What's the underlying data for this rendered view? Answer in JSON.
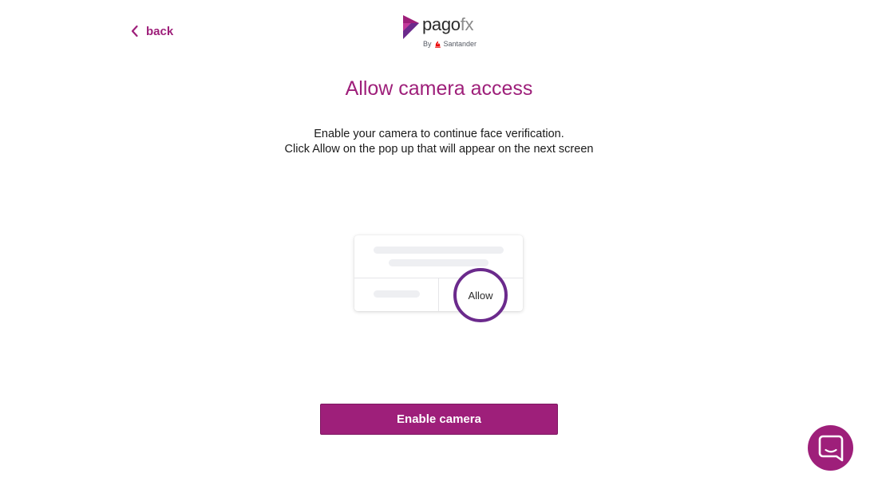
{
  "header": {
    "back_label": "back",
    "brand": {
      "name_part1": "pago",
      "name_part2": "fx",
      "byline_prefix": "By",
      "byline_company": "Santander"
    }
  },
  "main": {
    "title": "Allow camera access",
    "instructions": [
      "Enable your camera to continue face verification.",
      "Click Allow on the pop up that will appear on the next screen"
    ],
    "illustration": {
      "allow_label": "Allow"
    },
    "cta_label": "Enable camera"
  },
  "chat": {
    "icon": "chat-bubble-icon"
  },
  "colors": {
    "brand_primary": "#9e1f7a",
    "brand_purple": "#6b2a8c",
    "text_dark": "#1a1a1a",
    "placeholder_bar": "#eeeff2",
    "santander_red": "#ec0000"
  }
}
